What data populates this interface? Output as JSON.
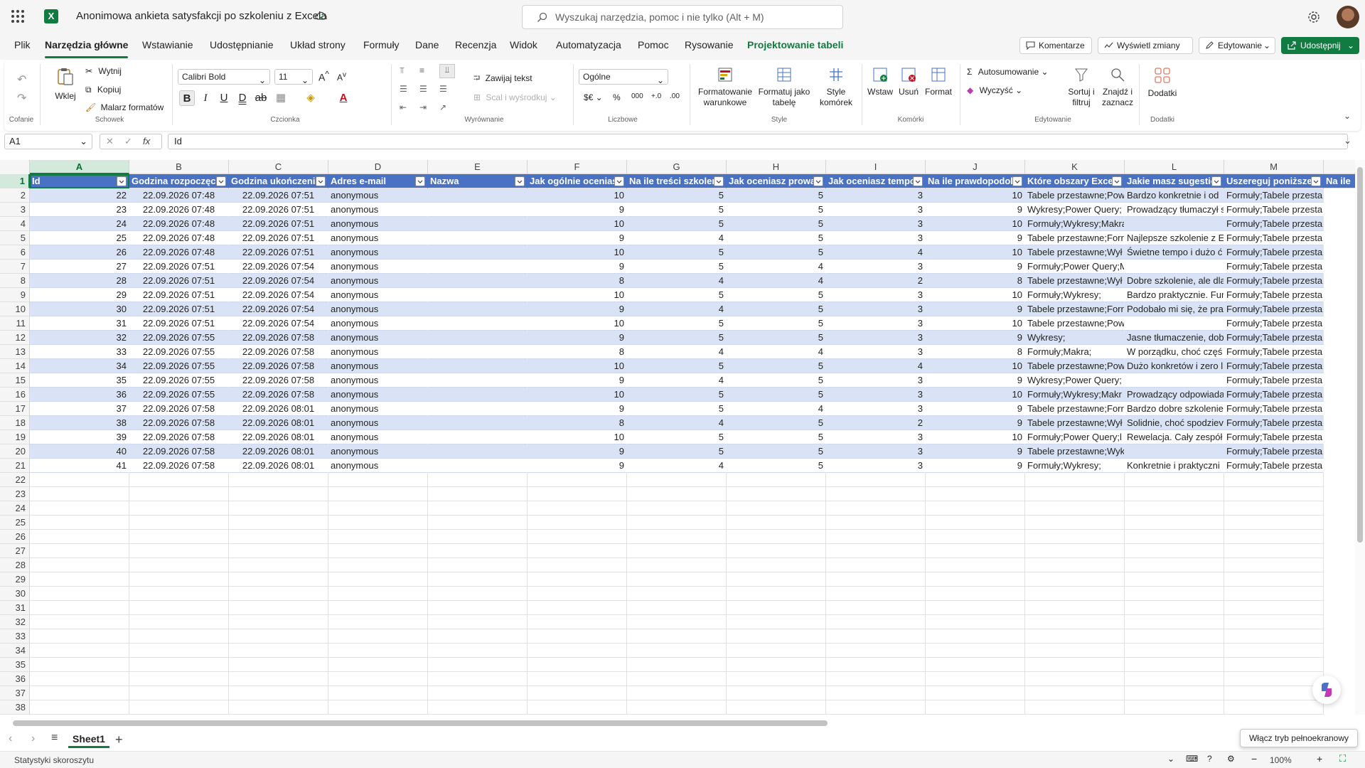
{
  "titlebar": {
    "doc_title": "Anonimowa ankieta satysfakcji po szkoleniu z Excela",
    "search_placeholder": "Wyszukaj narzędzia, pomoc i nie tylko (Alt + M)"
  },
  "menu": {
    "tabs": [
      "Plik",
      "Narzędzia główne",
      "Wstawianie",
      "Udostępnianie",
      "Układ strony",
      "Formuły",
      "Dane",
      "Recenzja",
      "Widok",
      "Automatyzacja",
      "Pomoc",
      "Rysowanie",
      "Projektowanie tabeli"
    ],
    "active": "Narzędzia główne",
    "comments": "Komentarze",
    "show_changes": "Wyświetl zmiany",
    "editing": "Edytowanie",
    "share": "Udostępnij"
  },
  "ribbon": {
    "undo_group": "Cofanie",
    "clipboard": {
      "paste": "Wklej",
      "cut": "Wytnij",
      "copy": "Kopiuj",
      "painter": "Malarz formatów",
      "group": "Schowek"
    },
    "font": {
      "name": "Calibri Bold",
      "size": "11",
      "group": "Czcionka"
    },
    "alignment": {
      "wrap": "Zawijaj tekst",
      "merge": "Scal i wyśrodkuj",
      "group": "Wyrównanie"
    },
    "number": {
      "format": "Ogólne",
      "group": "Liczbowe"
    },
    "styles": {
      "conditional": "Formatowanie warunkowe",
      "as_table": "Formatuj jako tabelę",
      "cell_styles": "Style komórek",
      "group": "Style"
    },
    "cells": {
      "insert": "Wstaw",
      "delete": "Usuń",
      "format": "Format",
      "group": "Komórki"
    },
    "editing": {
      "autosum": "Autosumowanie",
      "clear": "Wyczyść",
      "sort": "Sortuj i filtruj",
      "find": "Znajdź i zaznacz",
      "group": "Edytowanie"
    },
    "addins": {
      "label": "Dodatki",
      "group": "Dodatki"
    }
  },
  "formula_bar": {
    "name_box": "A1",
    "content": "Id"
  },
  "grid": {
    "columns": [
      "A",
      "B",
      "C",
      "D",
      "E",
      "F",
      "G",
      "H",
      "I",
      "J",
      "K",
      "L",
      "M"
    ],
    "headers": [
      "Id",
      "Godzina rozpoczęcia",
      "Godzina ukończenia",
      "Adres e-mail",
      "Nazwa",
      "Jak ogólnie oceniasz",
      "Na ile treści szkoleni",
      "Jak oceniasz prowad",
      "Jak oceniasz tempo",
      "Na ile prawdopodob",
      "Które obszary Excela",
      "Jakie masz sugestie",
      "Uszereguj poniższe"
    ],
    "extra_header": "Na ile",
    "rows": [
      [
        "22",
        "22.09.2026 07:48",
        "22.09.2026 07:51",
        "anonymous",
        "",
        "10",
        "5",
        "5",
        "3",
        "10",
        "Tabele przestawne;Pow",
        "Bardzo konkretnie i od",
        "Formuły;Tabele przesta"
      ],
      [
        "23",
        "22.09.2026 07:48",
        "22.09.2026 07:51",
        "anonymous",
        "",
        "9",
        "5",
        "5",
        "3",
        "9",
        "Wykresy;Power Query;",
        "Prowadzący tłumaczył s",
        "Formuły;Tabele przesta"
      ],
      [
        "24",
        "22.09.2026 07:48",
        "22.09.2026 07:51",
        "anonymous",
        "",
        "10",
        "5",
        "5",
        "3",
        "10",
        "Formuły;Wykresy;Makra;",
        "",
        "Formuły;Tabele przesta"
      ],
      [
        "25",
        "22.09.2026 07:48",
        "22.09.2026 07:51",
        "anonymous",
        "",
        "9",
        "4",
        "5",
        "3",
        "9",
        "Tabele przestawne;Forr",
        "Najlepsze szkolenie z E",
        "Formuły;Tabele przesta"
      ],
      [
        "26",
        "22.09.2026 07:48",
        "22.09.2026 07:51",
        "anonymous",
        "",
        "10",
        "5",
        "5",
        "4",
        "10",
        "Tabele przestawne;Wył",
        "Świetne tempo i dużo ć",
        "Formuły;Tabele przesta"
      ],
      [
        "27",
        "22.09.2026 07:51",
        "22.09.2026 07:54",
        "anonymous",
        "",
        "9",
        "5",
        "4",
        "3",
        "9",
        "Formuły;Power Query;Makra;",
        "",
        "Formuły;Tabele przesta"
      ],
      [
        "28",
        "22.09.2026 07:51",
        "22.09.2026 07:54",
        "anonymous",
        "",
        "8",
        "4",
        "4",
        "2",
        "8",
        "Tabele przestawne;Wył",
        "Dobre szkolenie, ale dla",
        "Formuły;Tabele przesta"
      ],
      [
        "29",
        "22.09.2026 07:51",
        "22.09.2026 07:54",
        "anonymous",
        "",
        "10",
        "5",
        "5",
        "3",
        "10",
        "Formuły;Wykresy;",
        "Bardzo praktycznie. Fur",
        "Formuły;Tabele przesta"
      ],
      [
        "30",
        "22.09.2026 07:51",
        "22.09.2026 07:54",
        "anonymous",
        "",
        "9",
        "4",
        "5",
        "3",
        "9",
        "Tabele przestawne;Forr",
        "Podobało mi się, że pra",
        "Formuły;Tabele przesta"
      ],
      [
        "31",
        "22.09.2026 07:51",
        "22.09.2026 07:54",
        "anonymous",
        "",
        "10",
        "5",
        "5",
        "3",
        "10",
        "Tabele przestawne;Power Query;",
        "",
        "Formuły;Tabele przesta"
      ],
      [
        "32",
        "22.09.2026 07:55",
        "22.09.2026 07:58",
        "anonymous",
        "",
        "9",
        "5",
        "5",
        "3",
        "9",
        "Wykresy;",
        "Jasne tłumaczenie, dob",
        "Formuły;Tabele przesta"
      ],
      [
        "33",
        "22.09.2026 07:55",
        "22.09.2026 07:58",
        "anonymous",
        "",
        "8",
        "4",
        "4",
        "3",
        "8",
        "Formuły;Makra;",
        "W porządku, choć częś",
        "Formuły;Tabele przesta"
      ],
      [
        "34",
        "22.09.2026 07:55",
        "22.09.2026 07:58",
        "anonymous",
        "",
        "10",
        "5",
        "5",
        "4",
        "10",
        "Tabele przestawne;Pow",
        "Dużo konkretów i zero l",
        "Formuły;Tabele przesta"
      ],
      [
        "35",
        "22.09.2026 07:55",
        "22.09.2026 07:58",
        "anonymous",
        "",
        "9",
        "4",
        "5",
        "3",
        "9",
        "Wykresy;Power Query;",
        "",
        "Formuły;Tabele przesta"
      ],
      [
        "36",
        "22.09.2026 07:55",
        "22.09.2026 07:58",
        "anonymous",
        "",
        "10",
        "5",
        "5",
        "3",
        "10",
        "Formuły;Wykresy;Makr",
        "Prowadzący odpowiada",
        "Formuły;Tabele przesta"
      ],
      [
        "37",
        "22.09.2026 07:58",
        "22.09.2026 08:01",
        "anonymous",
        "",
        "9",
        "5",
        "4",
        "3",
        "9",
        "Tabele przestawne;Forr",
        "Bardzo dobre szkolenie",
        "Formuły;Tabele przesta"
      ],
      [
        "38",
        "22.09.2026 07:58",
        "22.09.2026 08:01",
        "anonymous",
        "",
        "8",
        "4",
        "5",
        "2",
        "9",
        "Tabele przestawne;Wył",
        "Solidnie, choć spodziev",
        "Formuły;Tabele przesta"
      ],
      [
        "39",
        "22.09.2026 07:58",
        "22.09.2026 08:01",
        "anonymous",
        "",
        "10",
        "5",
        "5",
        "3",
        "10",
        "Formuły;Power Query;l",
        "Rewelacja. Cały zespół",
        "Formuły;Tabele przesta"
      ],
      [
        "40",
        "22.09.2026 07:58",
        "22.09.2026 08:01",
        "anonymous",
        "",
        "9",
        "5",
        "5",
        "3",
        "9",
        "Tabele przestawne;Wykresy;Power Query;",
        "",
        "Formuły;Tabele przesta"
      ],
      [
        "41",
        "22.09.2026 07:58",
        "22.09.2026 08:01",
        "anonymous",
        "",
        "9",
        "4",
        "5",
        "3",
        "9",
        "Formuły;Wykresy;",
        "Konkretnie i praktyczni",
        "Formuły;Tabele przesta"
      ]
    ],
    "row_numbers": [
      "1",
      "2",
      "3",
      "4",
      "5",
      "6",
      "7",
      "8",
      "9",
      "10",
      "11",
      "12",
      "13",
      "14",
      "15",
      "16",
      "17",
      "18",
      "19",
      "20",
      "21",
      "22",
      "23",
      "24",
      "25",
      "26",
      "27",
      "28",
      "29",
      "30",
      "31",
      "32",
      "33",
      "34",
      "35",
      "36",
      "37",
      "38"
    ]
  },
  "sheets": {
    "active": "Sheet1"
  },
  "tooltip": "Włącz tryb pełnoekranowy",
  "status": {
    "left": "Statystyki skoroszytu",
    "zoom": "100%"
  },
  "colors": {
    "brand": "#107c41",
    "table_header": "#4a72c4",
    "band": "#d9e3f5"
  }
}
